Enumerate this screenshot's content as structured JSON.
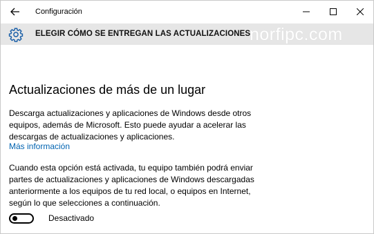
{
  "window": {
    "title": "Configuración"
  },
  "header": {
    "title": "ELEGIR CÓMO SE ENTREGAN LAS ACTUALIZACIONES",
    "watermark": "norfipc.com"
  },
  "main": {
    "section_title": "Actualizaciones de más de un lugar",
    "paragraph1": "Descarga actualizaciones y aplicaciones de Windows desde otros equipos, además de Microsoft. Esto puede ayudar a acelerar las descargas de actualizaciones y aplicaciones.",
    "more_info_link": "Más información",
    "paragraph2": "Cuando esta opción está activada, tu equipo también podrá enviar partes de actualizaciones y aplicaciones de Windows descargadas anteriormente a los equipos de tu red local, o equipos en Internet, según lo que selecciones a continuación.",
    "toggle": {
      "state": "off",
      "label": "Desactivado"
    }
  },
  "colors": {
    "header_band": "#e6e6e6",
    "link": "#0063b1",
    "gear_icon": "#1a5fa8"
  },
  "icons": [
    "back-arrow-icon",
    "minimize-icon",
    "maximize-icon",
    "close-icon",
    "gear-icon"
  ]
}
